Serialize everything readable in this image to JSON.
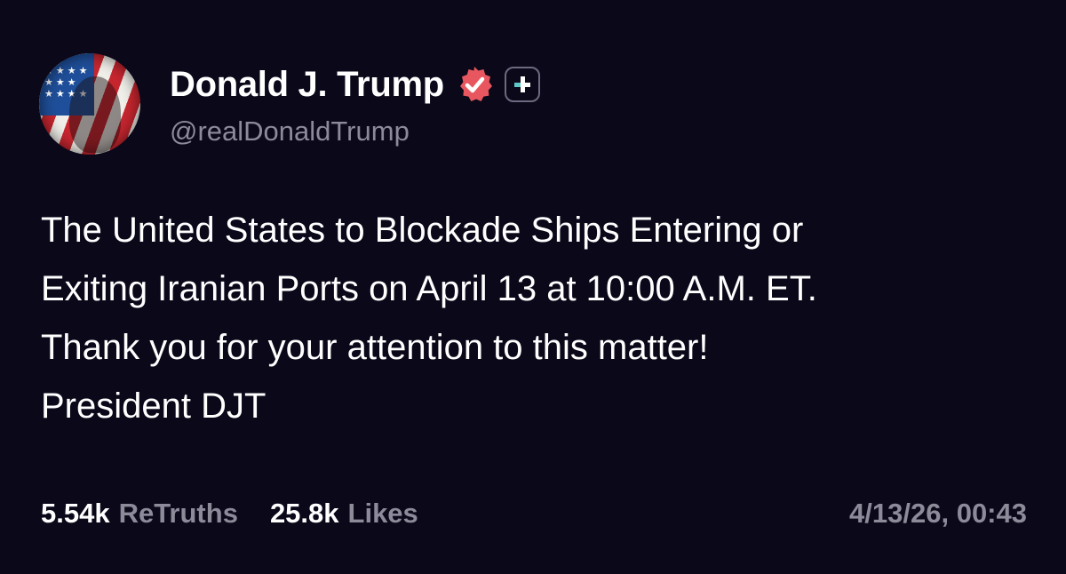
{
  "author": {
    "display_name": "Donald J. Trump",
    "handle": "@realDonaldTrump",
    "avatar_icon": "flag-portrait-avatar",
    "verified_icon": "verified-badge-icon",
    "verified_color": "#e8575f",
    "plus_icon": "plus-badge-icon",
    "plus_color": "#5ec8c9"
  },
  "post": {
    "lines": [
      "The United States to Blockade Ships Entering or",
      "Exiting Iranian Ports on April 13 at 10:00 A.M. ET.",
      "Thank you for your attention to this matter!",
      "President DJT"
    ]
  },
  "stats": {
    "retruths_count": "5.54k",
    "retruths_label": "ReTruths",
    "likes_count": "25.8k",
    "likes_label": "Likes",
    "timestamp": "4/13/26, 00:43"
  },
  "colors": {
    "background": "#0a0819",
    "text_primary": "#ffffff",
    "text_secondary": "#8d8a9a"
  }
}
